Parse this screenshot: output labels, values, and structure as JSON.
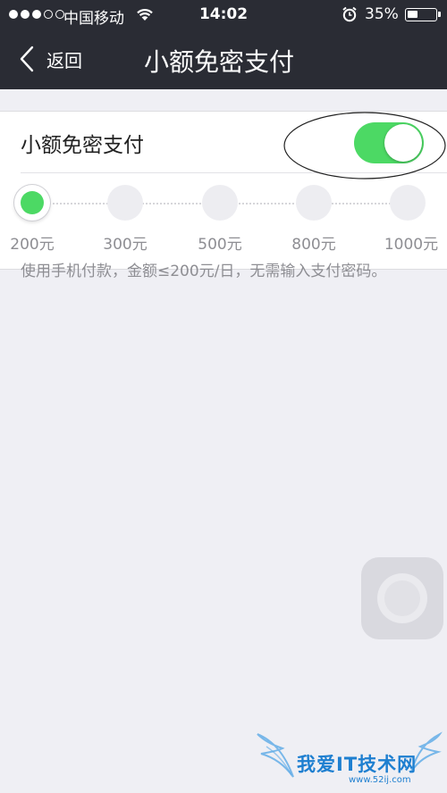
{
  "status_bar": {
    "carrier": "中国移动",
    "time": "14:02",
    "battery": "35%"
  },
  "nav": {
    "back_label": "返回",
    "title": "小额免密支付"
  },
  "setting": {
    "label": "小额免密支付",
    "toggle_on": true
  },
  "slider": {
    "stops": [
      "200元",
      "300元",
      "500元",
      "800元",
      "1000元"
    ],
    "selected": "200元"
  },
  "note": "使用手机付款，金额≤200元/日，无需输入支付密码。",
  "watermark": {
    "text": "我爱IT技术网",
    "sub": "www.52ij.com"
  },
  "colors": {
    "accent": "#4cd964",
    "nav_bg": "#2a2c34",
    "page_bg": "#efeff4"
  }
}
